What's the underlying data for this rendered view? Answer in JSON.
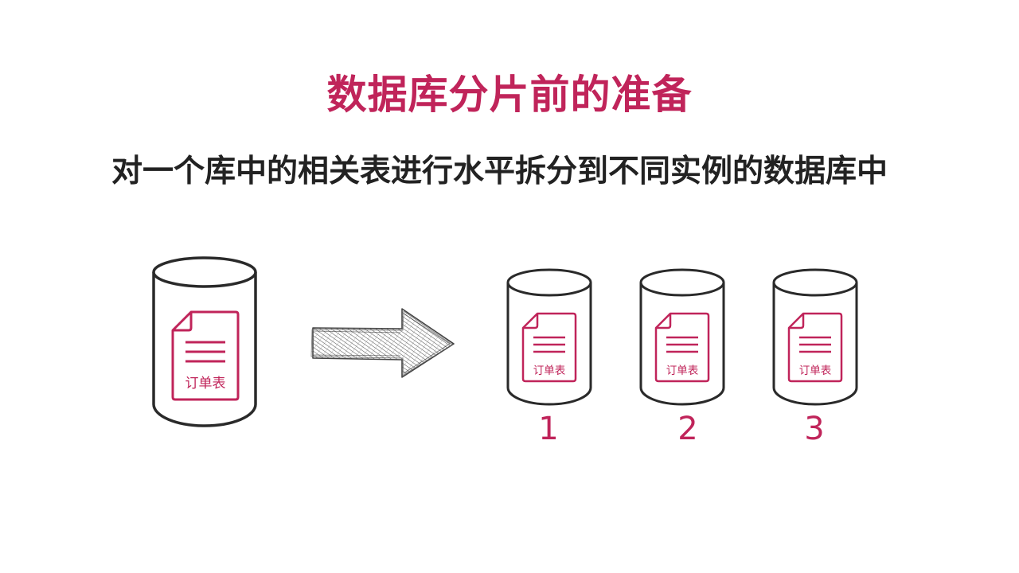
{
  "slide": {
    "title": "数据库分片前的准备",
    "subtitle": "对一个库中的相关表进行水平拆分到不同实例的数据库中"
  },
  "source_db": {
    "table_label": "订单表"
  },
  "shards": [
    {
      "table_label": "订单表",
      "number": "1"
    },
    {
      "table_label": "订单表",
      "number": "2"
    },
    {
      "table_label": "订单表",
      "number": "3"
    }
  ],
  "colors": {
    "accent": "#c0245a",
    "text": "#222222",
    "outline": "#2a2a2a",
    "background": "#ffffff"
  },
  "icons": {
    "database": "database-cylinder-icon",
    "document": "document-icon",
    "arrow": "sketch-arrow-right-icon"
  }
}
